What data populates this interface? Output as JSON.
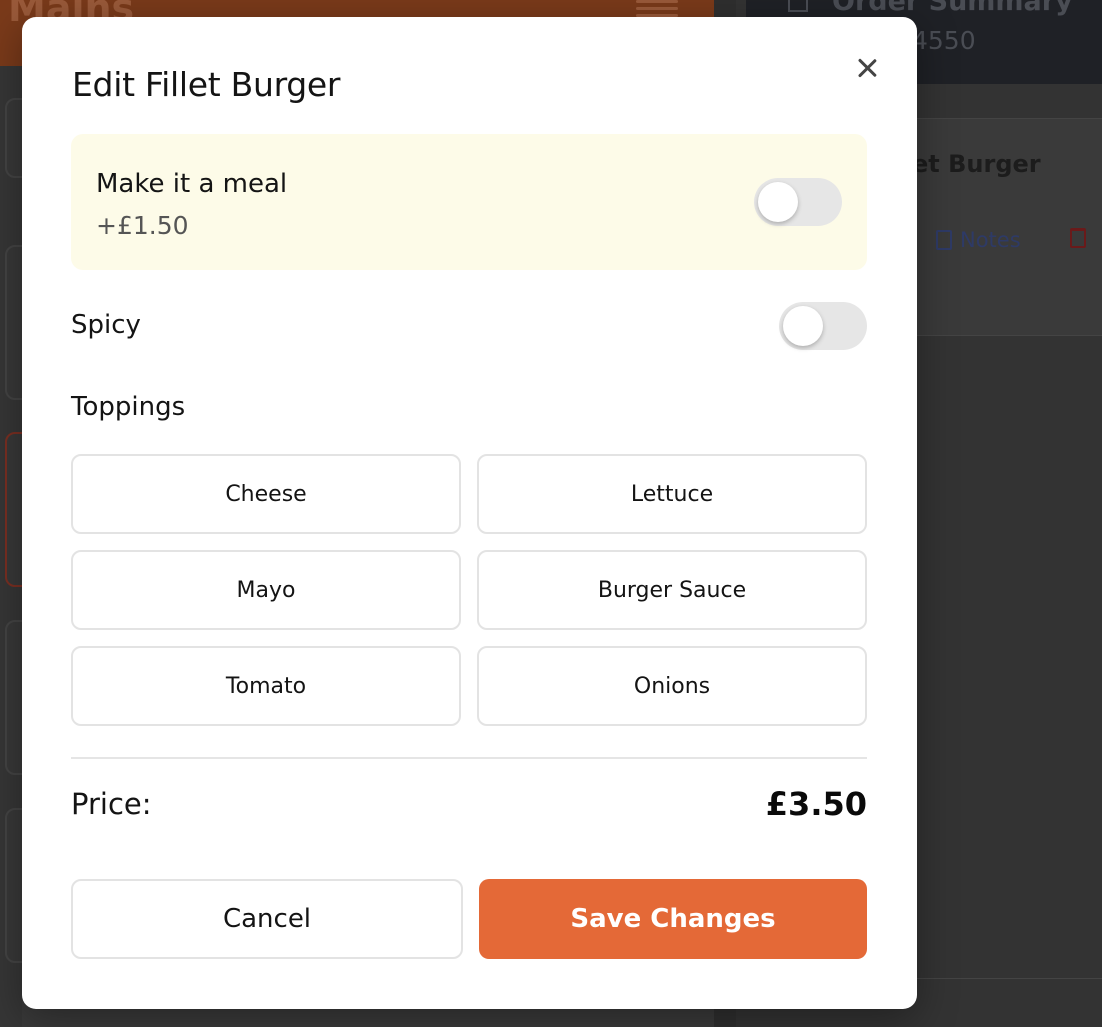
{
  "background": {
    "left_header_title": "Mains",
    "right_header_title": "Order Summary",
    "right_header_order": "4550",
    "item_name": "et Burger",
    "notes_label": "Notes"
  },
  "modal": {
    "title": "Edit Fillet Burger",
    "meal": {
      "label": "Make it a meal",
      "price": "+£1.50",
      "enabled": false
    },
    "spicy": {
      "label": "Spicy",
      "enabled": false
    },
    "toppings": {
      "label": "Toppings",
      "items": [
        "Cheese",
        "Lettuce",
        "Mayo",
        "Burger Sauce",
        "Tomato",
        "Onions"
      ]
    },
    "price": {
      "label": "Price:",
      "value": "£3.50"
    },
    "cancel_label": "Cancel",
    "save_label": "Save Changes"
  },
  "colors": {
    "accent": "#e46937",
    "meal_box": "#fdfbe8"
  }
}
